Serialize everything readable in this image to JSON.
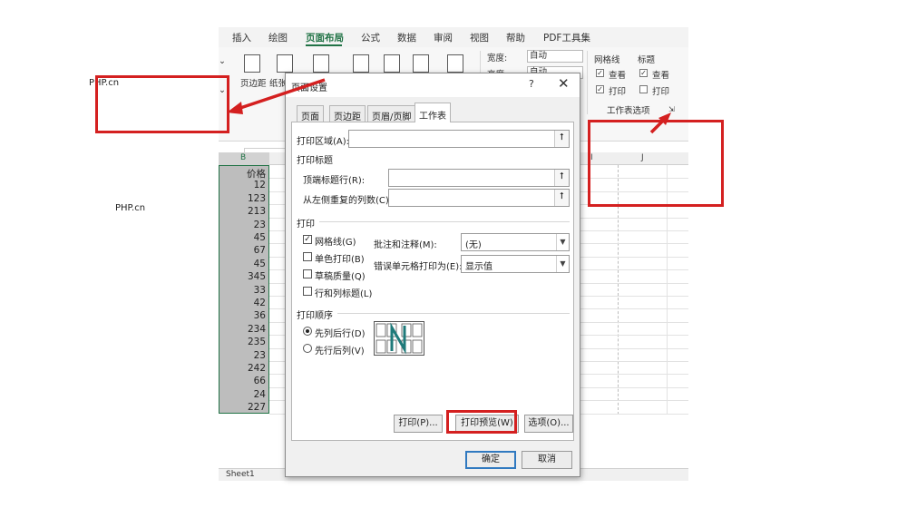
{
  "watermark": {
    "top": "PHP.cn",
    "middle": "PHP.cn"
  },
  "menubar": {
    "items": [
      "插入",
      "绘图",
      "页面布局",
      "公式",
      "数据",
      "审阅",
      "视图",
      "帮助",
      "PDF工具集"
    ]
  },
  "ribbon": {
    "margins_label": "页边距",
    "paper_label": "纸张",
    "width_label": "宽度:",
    "width_value": "自动",
    "height_label": "高度:",
    "height_value": "自动",
    "gridlines_title": "网格线",
    "headings_title": "标题",
    "view_label": "查看",
    "print_label": "打印",
    "sheet_options_label": "工作表选项"
  },
  "fxbar": {
    "cancel_symbol": "✕"
  },
  "columns": {
    "b": "B",
    "i": "I",
    "j": "J"
  },
  "column_b": {
    "header": "价格",
    "values": [
      "12",
      "123",
      "213",
      "23",
      "45",
      "67",
      "45",
      "345",
      "33",
      "42",
      "36",
      "234",
      "235",
      "23",
      "242",
      "66",
      "24",
      "227"
    ]
  },
  "sheet_tab": "Sheet1",
  "dialog": {
    "title": "页面设置",
    "help_symbol": "?",
    "close_symbol": "✕",
    "tabs": [
      "页面",
      "页边距",
      "页眉/页脚",
      "工作表"
    ],
    "print_area_label": "打印区域(A):",
    "print_titles_title": "打印标题",
    "top_rows_label": "顶端标题行(R):",
    "left_cols_label": "从左侧重复的列数(C):",
    "ref_symbol": "⭡",
    "print_group_title": "打印",
    "gridlines_label": "网格线(G)",
    "bw_label": "单色打印(B)",
    "draft_label": "草稿质量(Q)",
    "rowcol_label": "行和列标题(L)",
    "comments_label": "批注和注释(M):",
    "comments_value": "(无)",
    "errors_label": "错误单元格打印为(E):",
    "errors_value": "显示值",
    "order_title": "打印顺序",
    "down_then_over": "先列后行(D)",
    "over_then_down": "先行后列(V)",
    "print_button": "打印(P)...",
    "preview_button": "打印预览(W)",
    "options_button": "选项(O)...",
    "ok_button": "确定",
    "cancel_button": "取消"
  },
  "colors": {
    "annotation_red": "#d42020",
    "excel_green": "#217346"
  }
}
